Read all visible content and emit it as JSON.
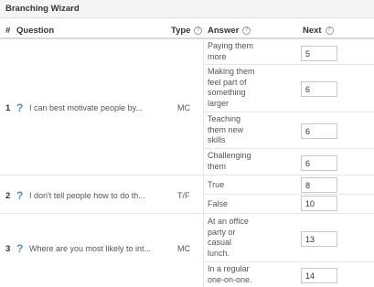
{
  "panel": {
    "title": "Branching Wizard"
  },
  "columns": {
    "num": "#",
    "question": "Question",
    "type": "Type",
    "answer": "Answer",
    "next": "Next"
  },
  "questions": [
    {
      "num": "1",
      "text": "I can best motivate people by...",
      "type": "MC",
      "answers": [
        {
          "lines": [
            "Paying them",
            "more"
          ],
          "next": "5"
        },
        {
          "lines": [
            "Making them",
            "feel part of",
            "something",
            "larger"
          ],
          "next": "6"
        },
        {
          "lines": [
            "Teaching",
            "them new",
            "skills"
          ],
          "next": "6"
        },
        {
          "lines": [
            "Challenging",
            "them"
          ],
          "next": "6"
        }
      ]
    },
    {
      "num": "2",
      "text": "I don't tell people how to do th...",
      "type": "T/F",
      "answers": [
        {
          "lines": [
            "True"
          ],
          "next": "8"
        },
        {
          "lines": [
            "False"
          ],
          "next": "10"
        }
      ]
    },
    {
      "num": "3",
      "text": "Where are you most likely to int...",
      "type": "MC",
      "answers": [
        {
          "lines": [
            "At an office",
            "party or",
            "casual",
            "lunch."
          ],
          "next": "13"
        },
        {
          "lines": [
            "In a regular",
            "one-on-one."
          ],
          "next": "14"
        }
      ]
    }
  ]
}
